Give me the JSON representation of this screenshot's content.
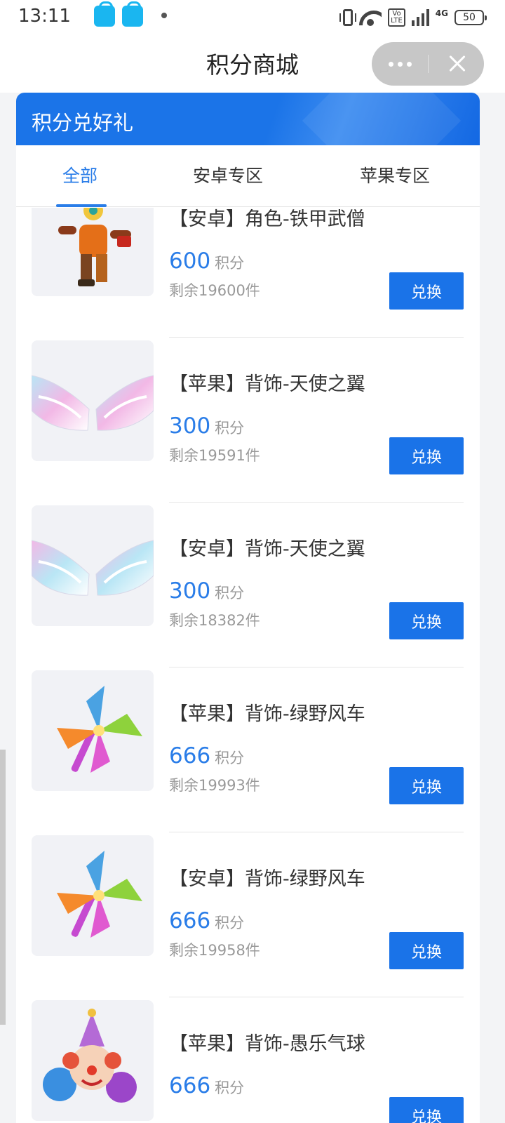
{
  "status_bar": {
    "time": "13:11",
    "network": "4G",
    "battery": "50",
    "volte": "Vo\nLTE"
  },
  "header": {
    "title": "积分商城"
  },
  "banner": {
    "title": "积分兑好礼"
  },
  "tabs": [
    {
      "label": "全部",
      "active": true
    },
    {
      "label": "安卓专区",
      "active": false
    },
    {
      "label": "苹果专区",
      "active": false
    }
  ],
  "items": [
    {
      "name": "【安卓】角色-铁甲武僧",
      "points": "600",
      "unit": "积分",
      "stock": "剩余19600件",
      "button": "兑换",
      "image": "armored-monk-icon"
    },
    {
      "name": "【苹果】背饰-天使之翼",
      "points": "300",
      "unit": "积分",
      "stock": "剩余19591件",
      "button": "兑换",
      "image": "angel-wings-icon"
    },
    {
      "name": "【安卓】背饰-天使之翼",
      "points": "300",
      "unit": "积分",
      "stock": "剩余18382件",
      "button": "兑换",
      "image": "angel-wings-icon"
    },
    {
      "name": "【苹果】背饰-绿野风车",
      "points": "666",
      "unit": "积分",
      "stock": "剩余19993件",
      "button": "兑换",
      "image": "pinwheel-icon"
    },
    {
      "name": "【安卓】背饰-绿野风车",
      "points": "666",
      "unit": "积分",
      "stock": "剩余19958件",
      "button": "兑换",
      "image": "pinwheel-icon"
    },
    {
      "name": "【苹果】背饰-愚乐气球",
      "points": "666",
      "unit": "积分",
      "stock": "",
      "button": "兑换",
      "image": "clown-balloon-icon"
    }
  ],
  "colors": {
    "accent": "#1a73e8",
    "tab_active": "#2a7de8",
    "muted": "#999999"
  }
}
